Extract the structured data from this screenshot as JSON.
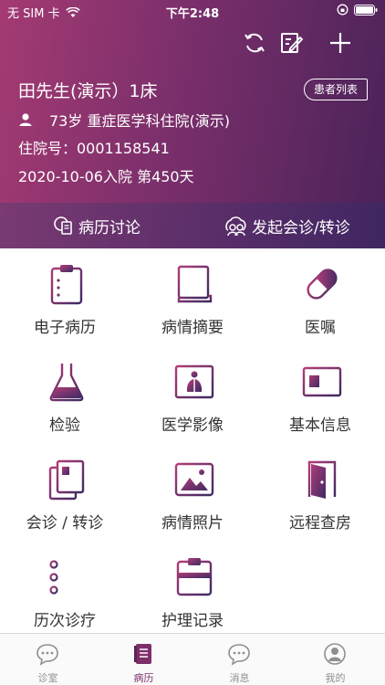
{
  "status_bar": {
    "carrier": "无 SIM 卡",
    "time": "下午2:48"
  },
  "header": {
    "toolbar_icons": [
      "refresh-icon",
      "edit-icon",
      "add-icon"
    ],
    "patient_name": "田先生(演示）1床",
    "patient_list_label": "患者列表",
    "age_hospital": "73岁  重症医学科住院(演示)",
    "admission_no": "住院号：0001158541",
    "admission_date": "2020-10-06入院   第450天"
  },
  "actions": {
    "discussion_label": "病历讨论",
    "consult_label": "发起会诊/转诊"
  },
  "grid": [
    {
      "label": "电子病历",
      "icon": "clipboard-icon"
    },
    {
      "label": "病情摘要",
      "icon": "document-scroll-icon"
    },
    {
      "label": "医嘱",
      "icon": "pill-icon"
    },
    {
      "label": "检验",
      "icon": "flask-icon"
    },
    {
      "label": "医学影像",
      "icon": "xray-icon"
    },
    {
      "label": "基本信息",
      "icon": "id-card-icon"
    },
    {
      "label": "会诊 / 转诊",
      "icon": "stacked-docs-icon"
    },
    {
      "label": "病情照片",
      "icon": "photo-icon"
    },
    {
      "label": "远程查房",
      "icon": "door-icon"
    },
    {
      "label": "历次诊疗",
      "icon": "timeline-list-icon"
    },
    {
      "label": "护理记录",
      "icon": "nursing-clipboard-icon"
    }
  ],
  "tabbar": [
    {
      "label": "诊室",
      "icon": "chat-bubble-icon",
      "active": false
    },
    {
      "label": "病历",
      "icon": "record-book-icon",
      "active": true
    },
    {
      "label": "消息",
      "icon": "message-icon",
      "active": false
    },
    {
      "label": "我的",
      "icon": "profile-icon",
      "active": false
    }
  ],
  "colors": {
    "accent": "#7d2f6a",
    "header_start": "#a43a73",
    "header_end": "#4b2359"
  }
}
